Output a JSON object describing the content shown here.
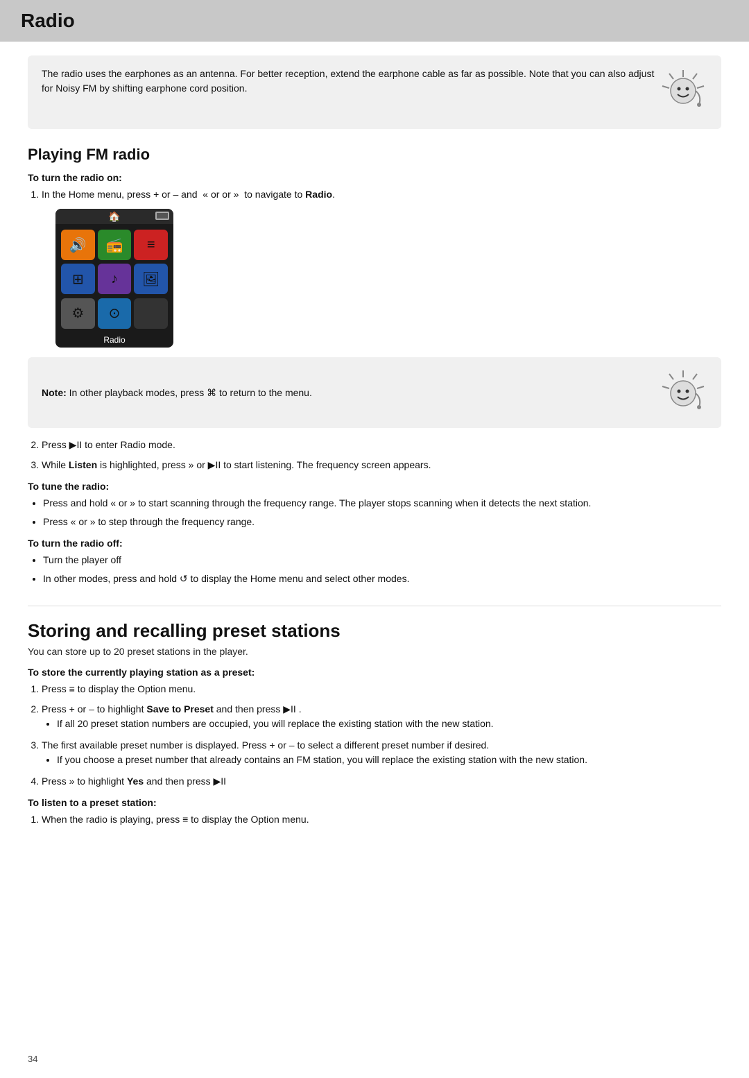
{
  "page": {
    "title": "Radio",
    "page_number": "34"
  },
  "top_note": {
    "text": "The radio uses the earphones as an antenna. For better reception, extend the earphone cable as far as possible. Note that you can also adjust for Noisy FM by shifting earphone cord position."
  },
  "playing_fm_radio": {
    "title": "Playing FM radio",
    "turn_on": {
      "heading": "To turn the radio on:",
      "steps": [
        "In the Home menu, press + or – and  ≪ or ≫ to navigate to Radio.",
        "Press ▶II to enter Radio mode.",
        "While Listen is highlighted, press ≫ or ▶II to start listening. The frequency screen appears."
      ],
      "device_label": "Radio"
    },
    "note2": {
      "text": "Note: In other playback modes, press ⌐ to return to the menu."
    },
    "tune": {
      "heading": "To tune the radio:",
      "bullets": [
        "Press and hold ≪ or ≫ to start scanning through the frequency range. The player stops scanning when it detects the next station.",
        "Press ≪ or ≫ to step through the frequency range."
      ]
    },
    "turn_off": {
      "heading": "To turn the radio off:",
      "bullets": [
        "Turn the player off",
        "In other modes, press and hold ↺ to display the Home menu and select other modes."
      ]
    }
  },
  "storing": {
    "title": "Storing and recalling preset stations",
    "subtitle": "You can store up to 20 preset stations in the player.",
    "store_preset": {
      "heading": "To store the currently playing station as a preset:",
      "steps": [
        "Press ≡ to display the Option menu.",
        "Press + or – to highlight Save to Preset and then press ▶II .",
        "The first available preset number is displayed. Press + or – to select a different preset number if desired.",
        "Press ≫ to highlight Yes and then press ▶II"
      ],
      "bullets_step2": [
        "If all 20 preset station numbers are occupied, you will replace the existing station with the new station."
      ],
      "bullets_step3": [
        "If you choose a preset number that already contains an FM station, you will replace the existing station with the new station."
      ]
    },
    "listen_preset": {
      "heading": "To listen to a preset station:",
      "steps": [
        "When the radio is playing, press ≡ to display the Option menu."
      ]
    }
  }
}
